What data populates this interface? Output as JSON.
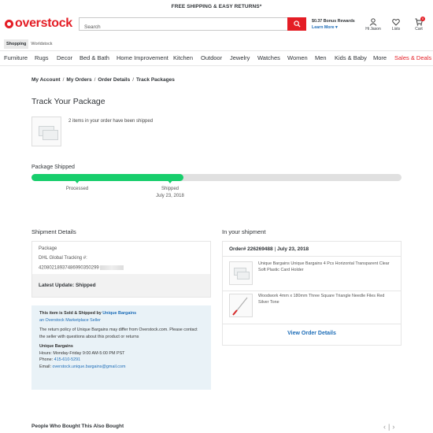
{
  "promo_banner": "FREE SHIPPING & EASY RETURNS*",
  "logo_text": "overstock",
  "search": {
    "placeholder": "Search"
  },
  "rewards": {
    "title": "$0.37 Bonus Rewards",
    "link": "Learn More"
  },
  "account": {
    "label": "Hi Jason"
  },
  "lists": {
    "label": "Lists"
  },
  "cart": {
    "label": "Cart",
    "count": "0"
  },
  "subtabs": [
    "Shopping",
    "Worldstock"
  ],
  "nav": [
    "Furniture",
    "Rugs",
    "Decor",
    "Bed & Bath",
    "Home Improvement",
    "Kitchen",
    "Outdoor",
    "Jewelry",
    "Watches",
    "Women",
    "Men",
    "Kids & Baby",
    "More",
    "Sales & Deals"
  ],
  "breadcrumb": [
    "My Account",
    "My Orders",
    "Order Details",
    "Track Packages"
  ],
  "page_title": "Track Your Package",
  "items_message": "2 items in your order have been shipped",
  "package_status_label": "Package Shipped",
  "progress": {
    "fraction": 0.41
  },
  "steps": [
    {
      "label": "Processed",
      "date": ""
    },
    {
      "label": "Shipped",
      "date": "July 23, 2018"
    }
  ],
  "shipment_details": {
    "title": "Shipment Details",
    "package_label": "Package",
    "carrier": "DHL Global Tracking #:",
    "tracking_number": "42080218937486990350299",
    "latest_update": "Latest Update: Shipped"
  },
  "seller": {
    "sold_by_prefix": "This item is Sold & Shipped by",
    "seller_name": "Unique Bargains",
    "marketplace": "an Overstock Marketplace Seller",
    "policy": "The return policy of Unique Bargains may differ from Overstock.com. Please contact the seller with questions about this product or returns",
    "contact_name": "Unique Bargains",
    "hours": "Hours: Monday-Friday 9:00 AM-5:00 PM PST",
    "phone_label": "Phone:",
    "phone": "415-610-5291",
    "email_label": "Email:",
    "email": "overstock.unique.bargains@gmail.com"
  },
  "in_shipment": {
    "title": "In your shipment",
    "order_label": "Order# 226269488",
    "order_date": "July 23, 2018",
    "items": [
      {
        "name": "Unique Bargains Unique Bargains 4 Pcs Horizontal Transparent Clear Soft Plastic Card Holder"
      },
      {
        "name": "Woodwork 4mm x 180mm Three Square Triangle Needle Files Red Silver Tone"
      }
    ],
    "view_order_label": "View Order Details"
  },
  "also_bought_title": "People Who Bought This Also Bought",
  "colors": {
    "accent": "#e41d25",
    "progress": "#17ce6c",
    "link": "#1c6cb7",
    "seller_bg": "#e9f2f7"
  },
  "icons": [
    "search-icon",
    "user-icon",
    "heart-icon",
    "cart-icon",
    "chevron-down-icon",
    "chevron-left-icon",
    "chevron-right-icon"
  ]
}
